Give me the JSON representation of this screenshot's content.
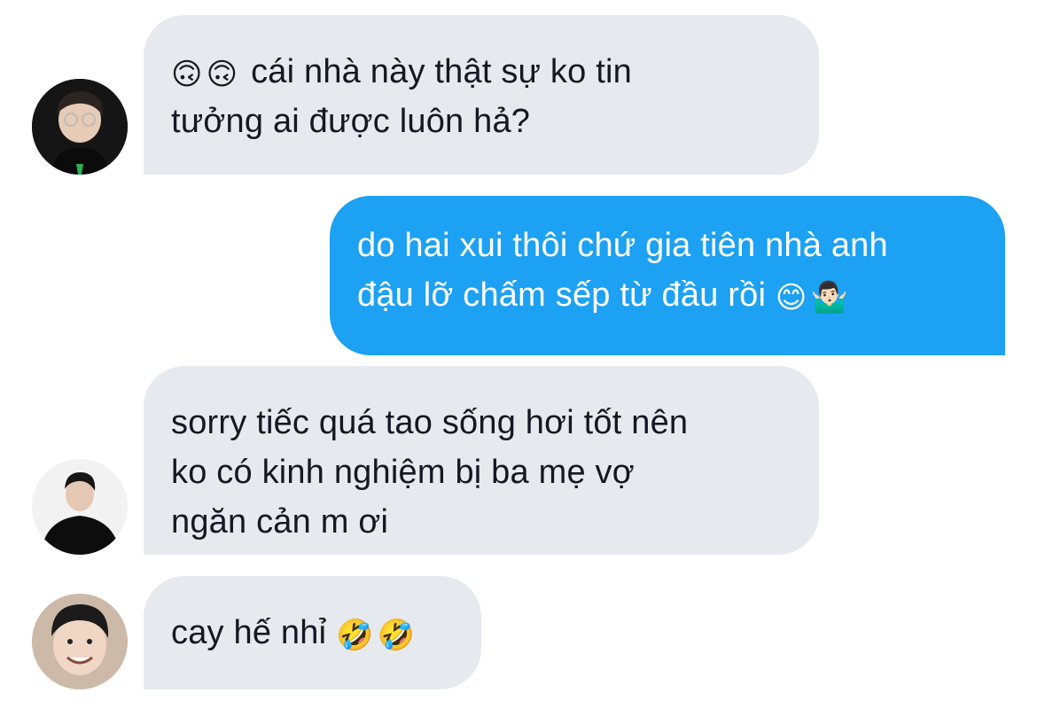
{
  "conversation": {
    "messages": [
      {
        "direction": "incoming",
        "lines": [
          {
            "emoji": [
              "🙃",
              "🙃"
            ],
            "text": "cái nhà này thật sự ko tin"
          },
          {
            "text": "tưởng ai được luôn hả?"
          }
        ],
        "avatar": "avatar-glasses-man"
      },
      {
        "direction": "outgoing",
        "lines": [
          {
            "text": "do hai xui thôi chứ gia tiên nhà anh"
          },
          {
            "text": "đậu lỡ chấm sếp từ đầu rồi",
            "emoji_after": [
              "😊",
              "🤷🏻‍♂️"
            ]
          }
        ]
      },
      {
        "direction": "incoming",
        "lines": [
          {
            "text": "sorry tiếc quá tao sống hơi tốt nên"
          },
          {
            "text": "ko có kinh nghiệm bị ba mẹ vợ"
          },
          {
            "text": "ngăn cản m ơi"
          }
        ],
        "avatar": "avatar-man-black-outfit"
      },
      {
        "direction": "incoming",
        "lines": [
          {
            "text": "cay hế nhỉ",
            "emoji_after": [
              "🤣",
              "🤣"
            ]
          }
        ],
        "avatar": "avatar-smiling-man"
      }
    ]
  },
  "colors": {
    "incoming_bubble": "#e6eaee",
    "outgoing_bubble": "#1da1f2",
    "incoming_text": "#141823",
    "outgoing_text": "#ffffff"
  }
}
